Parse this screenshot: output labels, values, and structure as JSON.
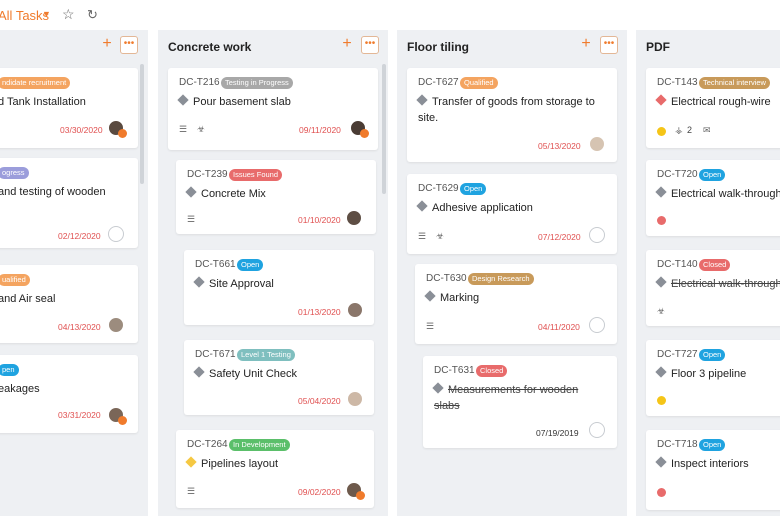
{
  "topbar": {
    "view_label": "All Tasks"
  },
  "columns": [
    {
      "title": "",
      "cards": [
        {
          "badge": "ndidate recruitment",
          "badge_color": "#f4a460",
          "title": "d Tank Installation",
          "date": "03/30/2020",
          "date_color": "#e05050"
        },
        {
          "badge": "ogress",
          "badge_color": "#9b9ddb",
          "title": "and testing of wooden",
          "date": "02/12/2020",
          "date_color": "#e05050"
        },
        {
          "badge": "ualified",
          "badge_color": "#f4a460",
          "title": "and Air seal",
          "date": "04/13/2020",
          "date_color": "#e05050"
        },
        {
          "badge": "pen",
          "badge_color": "#1fa3e0",
          "title": "eakages",
          "date": "03/31/2020",
          "date_color": "#e05050"
        }
      ]
    },
    {
      "title": "Concrete work",
      "cards": [
        {
          "id": "DC-T216",
          "badge": "Testing in Progress",
          "badge_color": "#a8a8a8",
          "title": "Pour basement slab",
          "date": "09/11/2020",
          "date_color": "#e05050"
        },
        {
          "id": "DC-T239",
          "badge": "Issues Found",
          "badge_color": "#e86b6b",
          "title": "Concrete Mix",
          "date": "01/10/2020",
          "date_color": "#e05050"
        },
        {
          "id": "DC-T661",
          "badge": "Open",
          "badge_color": "#1fa3e0",
          "title": "Site Approval",
          "date": "01/13/2020",
          "date_color": "#e05050"
        },
        {
          "id": "DC-T671",
          "badge": "Level 1 Testing",
          "badge_color": "#7fbfbf",
          "title": "Safety Unit Check",
          "date": "05/04/2020",
          "date_color": "#e05050"
        },
        {
          "id": "DC-T264",
          "badge": "In Development",
          "badge_color": "#5bbf6a",
          "title": "Pipelines layout",
          "date": "09/02/2020",
          "date_color": "#e05050"
        }
      ]
    },
    {
      "title": "Floor tiling",
      "cards": [
        {
          "id": "DC-T627",
          "badge": "Qualified",
          "badge_color": "#f4a460",
          "title": "Transfer of goods from storage to",
          "title2": "site.",
          "date": "05/13/2020",
          "date_color": "#e05050"
        },
        {
          "id": "DC-T629",
          "badge": "Open",
          "badge_color": "#1fa3e0",
          "title": "Adhesive application",
          "date": "07/12/2020",
          "date_color": "#e05050"
        },
        {
          "id": "DC-T630",
          "badge": "Design Research",
          "badge_color": "#c89a5a",
          "title": "Marking",
          "date": "04/11/2020",
          "date_color": "#e05050"
        },
        {
          "id": "DC-T631",
          "badge": "Closed",
          "badge_color": "#e86b6b",
          "title": "Measurements for wooden",
          "title2": "slabs",
          "date": "07/19/2019",
          "date_color": "#333333"
        }
      ]
    },
    {
      "title": "PDF",
      "cards": [
        {
          "id": "DC-T143",
          "badge": "Technical interview",
          "badge_color": "#c89a5a",
          "title": "Electrical rough-wire",
          "tag_count": "2"
        },
        {
          "id": "DC-T720",
          "badge": "Open",
          "badge_color": "#1fa3e0",
          "title": "Electrical walk-through"
        },
        {
          "id": "DC-T140",
          "badge": "Closed",
          "badge_color": "#e86b6b",
          "title": "Electrical walk-through"
        },
        {
          "id": "DC-T727",
          "badge": "Open",
          "badge_color": "#1fa3e0",
          "title": "Floor 3 pipeline"
        },
        {
          "id": "DC-T718",
          "badge": "Open",
          "badge_color": "#1fa3e0",
          "title": "Inspect interiors"
        }
      ]
    }
  ]
}
